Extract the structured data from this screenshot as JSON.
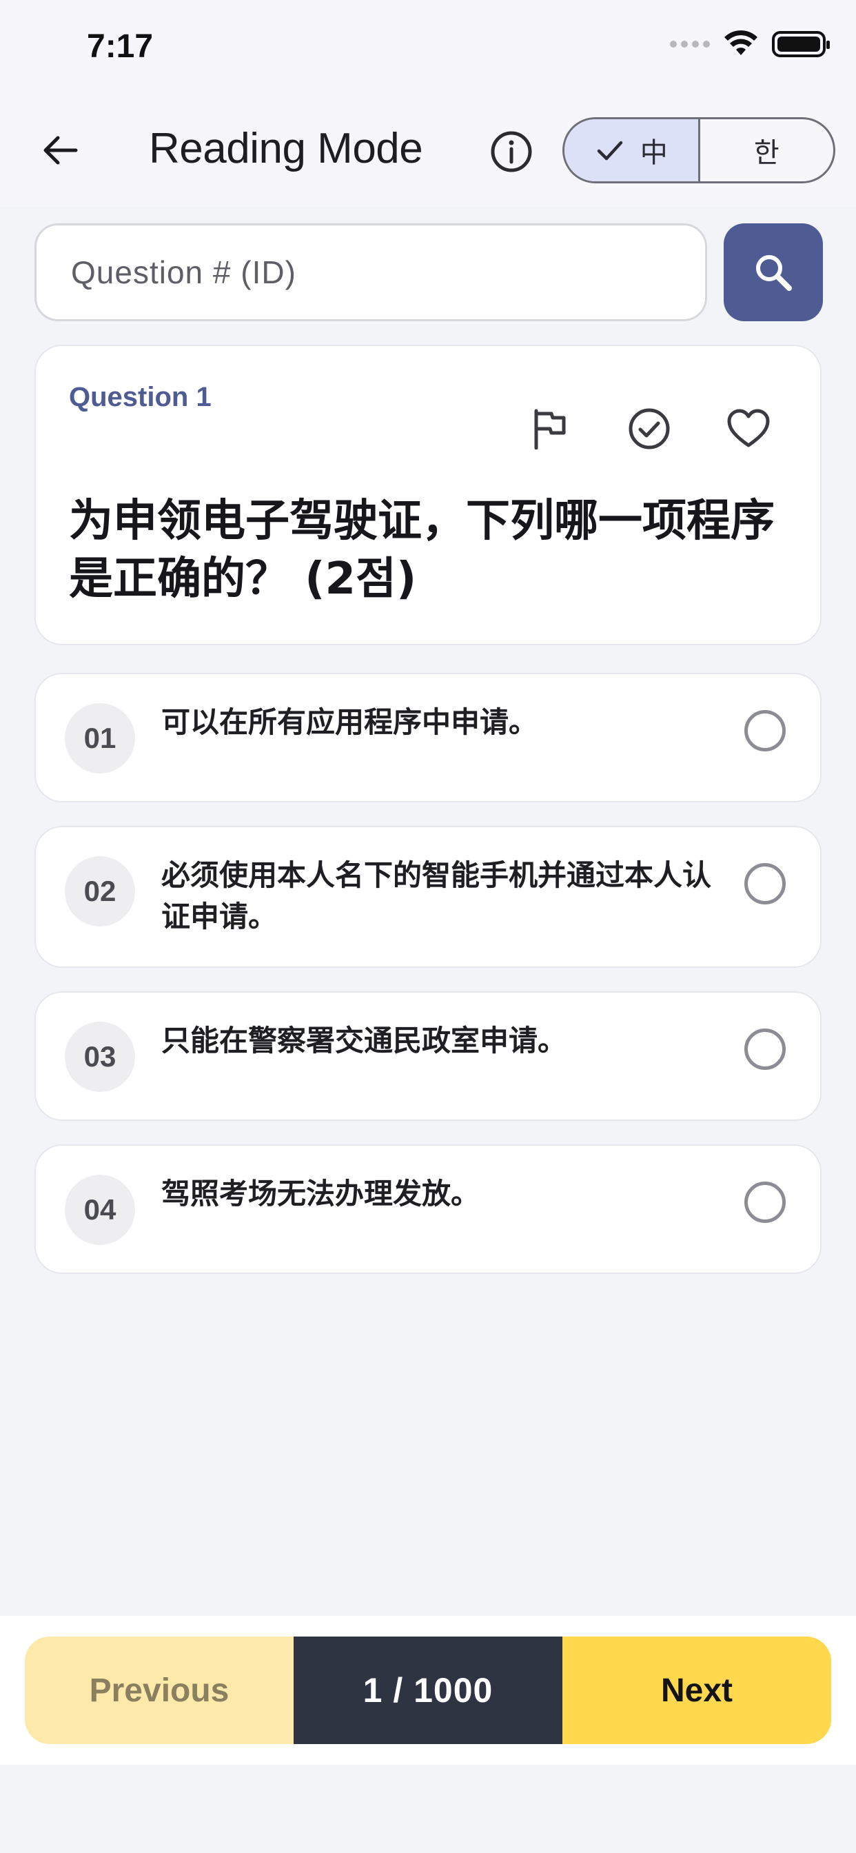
{
  "status_bar": {
    "time": "7:17",
    "icons": [
      "signal-icon",
      "wifi-icon",
      "battery-icon"
    ]
  },
  "app_bar": {
    "back_icon": "arrow-left-icon",
    "title": "Reading Mode",
    "info_icon": "info-icon",
    "language_toggle": {
      "options": [
        {
          "label": "中",
          "selected": true
        },
        {
          "label": "한",
          "selected": false
        }
      ]
    }
  },
  "search": {
    "placeholder": "Question # (ID)",
    "value": "",
    "button_icon": "search-icon",
    "accent_color": "#4f5b93"
  },
  "question": {
    "number_label": "Question 1",
    "text": "为申领电子驾驶证，下列哪一项程序是正确的？ (2점)",
    "actions": [
      "flag-icon",
      "check-circle-icon",
      "heart-icon"
    ]
  },
  "options": [
    {
      "num": "01",
      "text": "可以在所有应用程序中申请。"
    },
    {
      "num": "02",
      "text": "必须使用本人名下的智能手机并通过本人认证申请。"
    },
    {
      "num": "03",
      "text": "只能在警察署交通民政室申请。"
    },
    {
      "num": "04",
      "text": "驾照考场无法办理发放。"
    }
  ],
  "navigation": {
    "previous_label": "Previous",
    "counter": "1 / 1000",
    "next_label": "Next"
  }
}
